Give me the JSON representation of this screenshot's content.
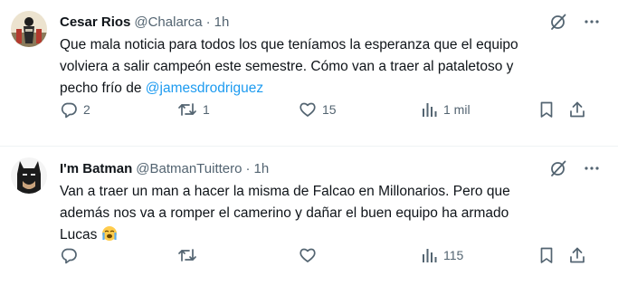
{
  "tweets": [
    {
      "author_name": "Cesar Rios",
      "handle": "@Chalarca",
      "separator": "·",
      "time": "1h",
      "text_line1": "Que mala noticia para todos los que teníamos la esperanza que el equipo",
      "text_line2": "volviera a salir campeón este semestre. Cómo van a traer al pataletoso y",
      "text_line3_prefix": "pecho frío de ",
      "mention": "@jamesdrodriguez",
      "replies": "2",
      "reposts": "1",
      "likes": "15",
      "views": "1 mil"
    },
    {
      "author_name": "I'm Batman",
      "handle": "@BatmanTuittero",
      "separator": "·",
      "time": "1h",
      "text_line1": "Van a traer un man a hacer la misma de Falcao en Millonarios. Pero que",
      "text_line2": "además nos va a romper el camerino y dañar el buen equipo ha armado",
      "text_line3_prefix": "Lucas ",
      "emoji": "loudly-crying-face",
      "replies": "",
      "reposts": "",
      "likes": "",
      "views": "115"
    }
  ],
  "icons": {
    "top": [
      "grok-icon",
      "more-icon"
    ],
    "actions": [
      "reply-icon",
      "repost-icon",
      "like-icon",
      "views-icon",
      "bookmark-icon",
      "share-icon"
    ]
  },
  "colors": {
    "text": "#0f1419",
    "muted": "#536471",
    "link": "#1d9bf0",
    "divider": "#eff3f4"
  }
}
